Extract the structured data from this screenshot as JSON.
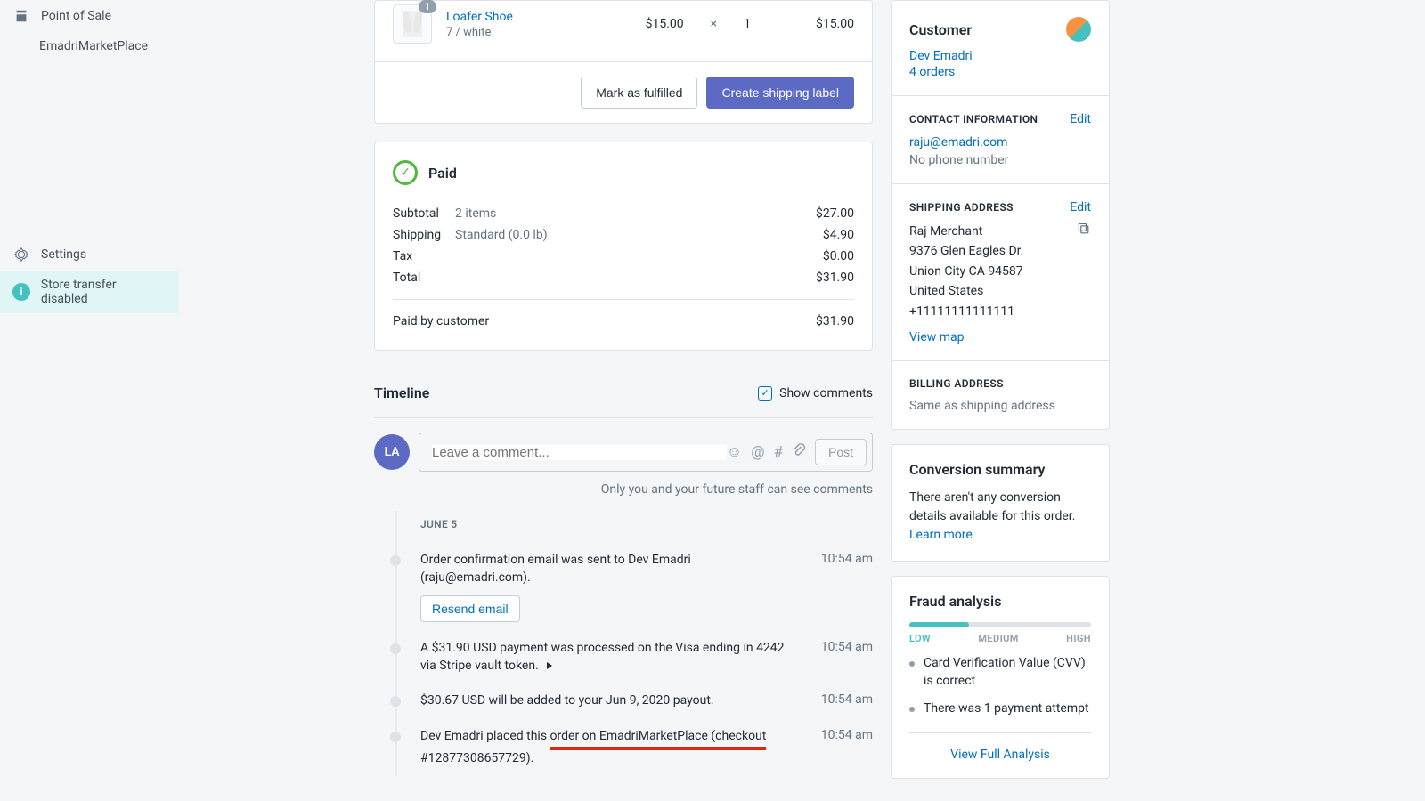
{
  "sidebar": {
    "pos": "Point of Sale",
    "marketplace": "EmadriMarketPlace",
    "settings": "Settings",
    "transfer": "Store transfer disabled"
  },
  "lineItem": {
    "qty": "1",
    "title": "Loafer Shoe",
    "variant": "7 / white",
    "price": "$15.00",
    "mult": "×",
    "qtyNum": "1",
    "total": "$15.00"
  },
  "actions": {
    "fulfill": "Mark as fulfilled",
    "shipLabel": "Create shipping label"
  },
  "paid": {
    "title": "Paid",
    "subtotal_l": "Subtotal",
    "subtotal_d": "2 items",
    "subtotal_a": "$27.00",
    "shipping_l": "Shipping",
    "shipping_d": "Standard (0.0 lb)",
    "shipping_a": "$4.90",
    "tax_l": "Tax",
    "tax_a": "$0.00",
    "total_l": "Total",
    "total_a": "$31.90",
    "paidby_l": "Paid by customer",
    "paidby_a": "$31.90"
  },
  "timeline": {
    "title": "Timeline",
    "show_comments": "Show comments",
    "avatar": "LA",
    "placeholder": "Leave a comment...",
    "post": "Post",
    "note": "Only you and your future staff can see comments",
    "date": "JUNE 5",
    "e1": {
      "text": "Order confirmation email was sent to Dev Emadri (raju@emadri.com).",
      "time": "10:54 am",
      "btn": "Resend email"
    },
    "e2": {
      "text": "A $31.90 USD payment was processed on the Visa ending in 4242 via Stripe vault token.",
      "time": "10:54 am"
    },
    "e3": {
      "text": "$30.67 USD will be added to your Jun 9, 2020 payout.",
      "time": "10:54 am"
    },
    "e4": {
      "pre": "Dev Emadri placed this ",
      "ul": "order on EmadriMarketPlace (checkout",
      "post": " #12877308657729).",
      "time": "10:54 am"
    }
  },
  "customer": {
    "title": "Customer",
    "name": "Dev Emadri",
    "orders": "4 orders",
    "contact_h": "CONTACT INFORMATION",
    "edit": "Edit",
    "email": "raju@emadri.com",
    "no_phone": "No phone number",
    "ship_h": "SHIPPING ADDRESS",
    "addr1": "Raj Merchant",
    "addr2": "9376 Glen Eagles Dr.",
    "addr3": "Union City CA 94587",
    "addr4": "United States",
    "addr5": "+11111111111111",
    "view_map": "View map",
    "bill_h": "BILLING ADDRESS",
    "bill_same": "Same as shipping address"
  },
  "conversion": {
    "title": "Conversion summary",
    "text": "There aren't any conversion details available for this order. ",
    "learn": "Learn more"
  },
  "fraud": {
    "title": "Fraud analysis",
    "low": "LOW",
    "med": "MEDIUM",
    "high": "HIGH",
    "item1": "Card Verification Value (CVV) is correct",
    "item2": "There was 1 payment attempt",
    "view": "View Full Analysis"
  }
}
